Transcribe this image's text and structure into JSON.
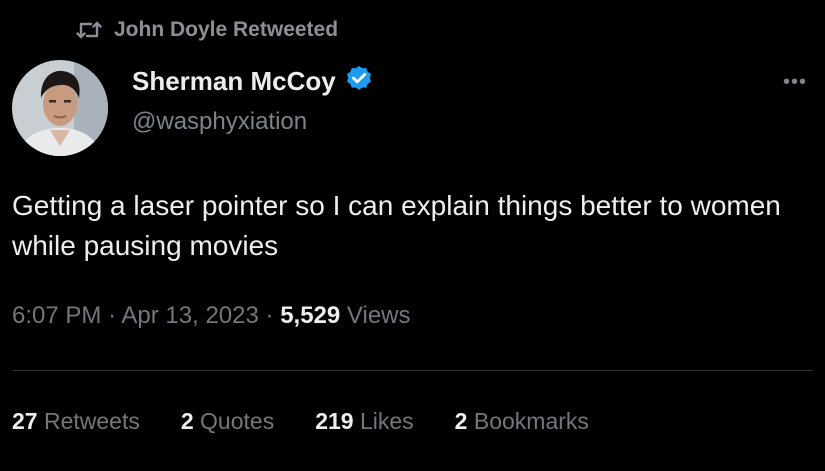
{
  "retweet_header": {
    "icon": "retweet-icon",
    "text": "John Doyle Retweeted"
  },
  "author": {
    "name": "Sherman McCoy",
    "handle": "@wasphyxiation",
    "verified": true,
    "verified_icon": "verified-badge-icon",
    "avatar": "avatar"
  },
  "more_menu_icon": "more-icon",
  "tweet": {
    "text": "Getting a laser pointer so I can explain things better to women while pausing movies"
  },
  "meta": {
    "time": "6:07 PM",
    "separator": "·",
    "date": "Apr 13, 2023",
    "views_count": "5,529",
    "views_label": "Views"
  },
  "stats": [
    {
      "count": "27",
      "label": "Retweets"
    },
    {
      "count": "2",
      "label": "Quotes"
    },
    {
      "count": "219",
      "label": "Likes"
    },
    {
      "count": "2",
      "label": "Bookmarks"
    }
  ],
  "colors": {
    "background": "#000000",
    "primary_text": "#e7e9ea",
    "secondary_text": "#72777d",
    "verified_blue": "#1d9bf0",
    "divider": "#2f3336"
  }
}
